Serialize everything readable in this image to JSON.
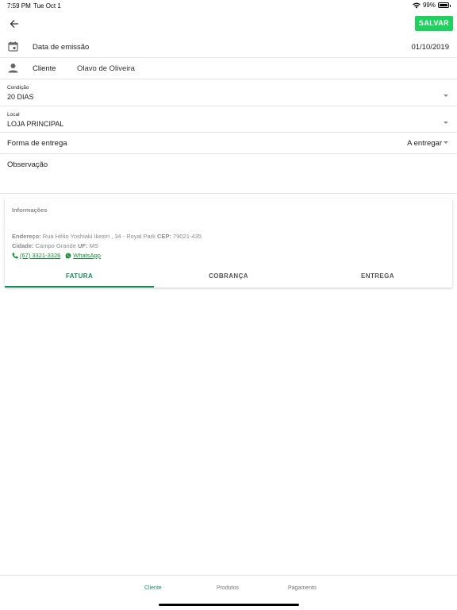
{
  "status_bar": {
    "time": "7:59 PM",
    "date": "Tue Oct 1",
    "battery": "99%"
  },
  "toolbar": {
    "back_icon": "arrow-left-icon",
    "save_label": "SALVAR",
    "save_color": "#21d160"
  },
  "form": {
    "emissao": {
      "label": "Data de emissão",
      "value": "01/10/2019",
      "icon": "calendar-icon"
    },
    "cliente": {
      "label": "Cliente",
      "value": "Olavo de Oliveira",
      "icon": "person-icon"
    },
    "condicao": {
      "label": "Condição",
      "value": "20 DIAS"
    },
    "local": {
      "label": "Local",
      "value": "LOJA PRINCIPAL"
    },
    "entrega": {
      "label": "Forma de entrega",
      "value": "A entregar"
    },
    "observacao": {
      "label": "Observação"
    }
  },
  "info_card": {
    "title": "Informações",
    "endereco_label": "Endereço:",
    "endereco_value": "Rua Hélio Yoshiaki Ikeziri , 34 - Royal Park",
    "cep_label": "CEP:",
    "cep_value": "79021-435",
    "cidade_label": "Cidade:",
    "cidade_value": "Campo Grande",
    "uf_label": "UF:",
    "uf_value": "MS",
    "phone": "(67) 3321-3326",
    "whatsapp": "WhatsApp",
    "tabs": [
      "FATURA",
      "COBRANÇA",
      "ENTREGA"
    ],
    "active_tab": "FATURA",
    "accent_color": "#1b8a5a"
  },
  "bottom_nav": {
    "items": [
      "Cliente",
      "Produtos",
      "Pagamento"
    ],
    "active": "Cliente"
  }
}
